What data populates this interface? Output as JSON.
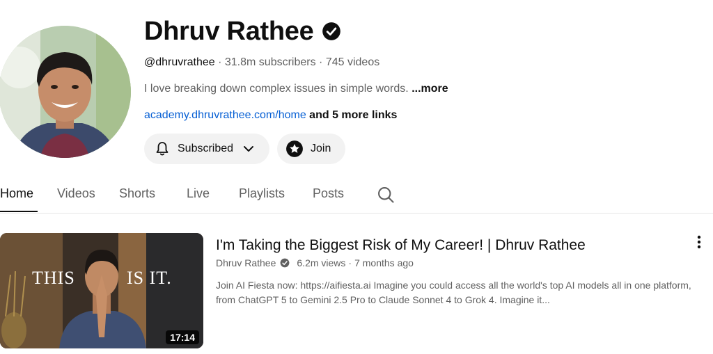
{
  "channel": {
    "name": "Dhruv Rathee",
    "handle": "@dhruvrathee",
    "subscribers": "31.8m subscribers",
    "videos_count": "745 videos",
    "description": "I love breaking down complex issues in simple words.",
    "more_label": "...more",
    "link": "academy.dhruvrathee.com/home",
    "more_links": "and 5 more links"
  },
  "buttons": {
    "subscribed_label": "Subscribed",
    "join_label": "Join"
  },
  "tabs": [
    {
      "label": "Home",
      "active": true
    },
    {
      "label": "Videos"
    },
    {
      "label": "Shorts"
    },
    {
      "label": "Live"
    },
    {
      "label": "Playlists"
    },
    {
      "label": "Posts"
    }
  ],
  "featured_video": {
    "title": "I'm Taking the Biggest Risk of My Career! | Dhruv Rathee",
    "channel": "Dhruv Rathee",
    "views": "6.2m views",
    "age": "7 months ago",
    "description": "Join AI Fiesta now: https://aifiesta.ai Imagine you could access all the world's top AI models all in one platform, from ChatGPT 5 to Gemini 2.5 Pro to Claude Sonnet 4 to Grok 4. Imagine it...",
    "duration": "17:14",
    "thumb_text_left": "THIS",
    "thumb_text_right": "IS IT."
  },
  "separators": {
    "dot": "·"
  },
  "icons": [
    "verified-icon",
    "bell-icon",
    "chevron-down-icon",
    "star-icon",
    "search-icon",
    "more-vert-icon"
  ],
  "colors": {
    "link": "#065fd4",
    "button_bg": "#f2f2f2",
    "text_secondary": "#606060"
  }
}
